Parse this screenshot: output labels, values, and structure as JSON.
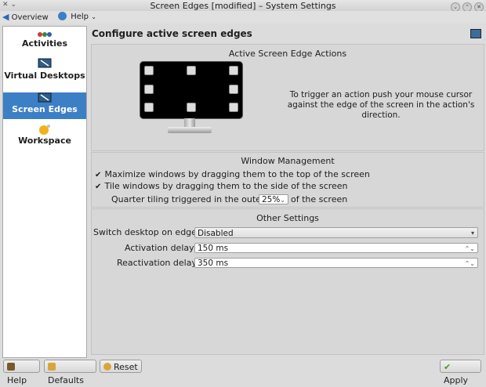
{
  "window": {
    "title": "Screen Edges [modified] – System Settings"
  },
  "toolbar": {
    "overview": "Overview",
    "help": "Help"
  },
  "sidebar": {
    "items": [
      {
        "label": "Activities",
        "icon": "activities-icon"
      },
      {
        "label": "Virtual Desktops",
        "icon": "virtual-desktops-icon"
      },
      {
        "label": "Screen Edges",
        "icon": "screen-edges-icon",
        "selected": true
      },
      {
        "label": "Workspace",
        "icon": "workspace-icon"
      }
    ]
  },
  "main": {
    "heading": "Configure active screen edges",
    "edge_actions": {
      "title": "Active Screen Edge Actions",
      "description": "To trigger an action push your mouse cursor against the edge of the screen in the action's direction."
    },
    "window_management": {
      "title": "Window Management",
      "maximize_label": "Maximize windows by dragging them to the top of the screen",
      "maximize_checked": true,
      "tile_label": "Tile windows by dragging them to the side of the screen",
      "tile_checked": true,
      "quarter_prefix": "Quarter tiling triggered in the outer",
      "quarter_value": "25%",
      "quarter_suffix": "of the screen"
    },
    "other_settings": {
      "title": "Other Settings",
      "switch_label": "Switch desktop on edge:",
      "switch_value": "Disabled",
      "activation_label": "Activation delay:",
      "activation_value": "150 ms",
      "reactivation_label": "Reactivation delay:",
      "reactivation_value": "350 ms"
    }
  },
  "buttons": {
    "help": "Help",
    "defaults": "Defaults",
    "reset": "Reset",
    "apply": "Apply"
  },
  "colors": {
    "selection": "#3d7fc5",
    "apply_icon": "#4a9a2a"
  }
}
